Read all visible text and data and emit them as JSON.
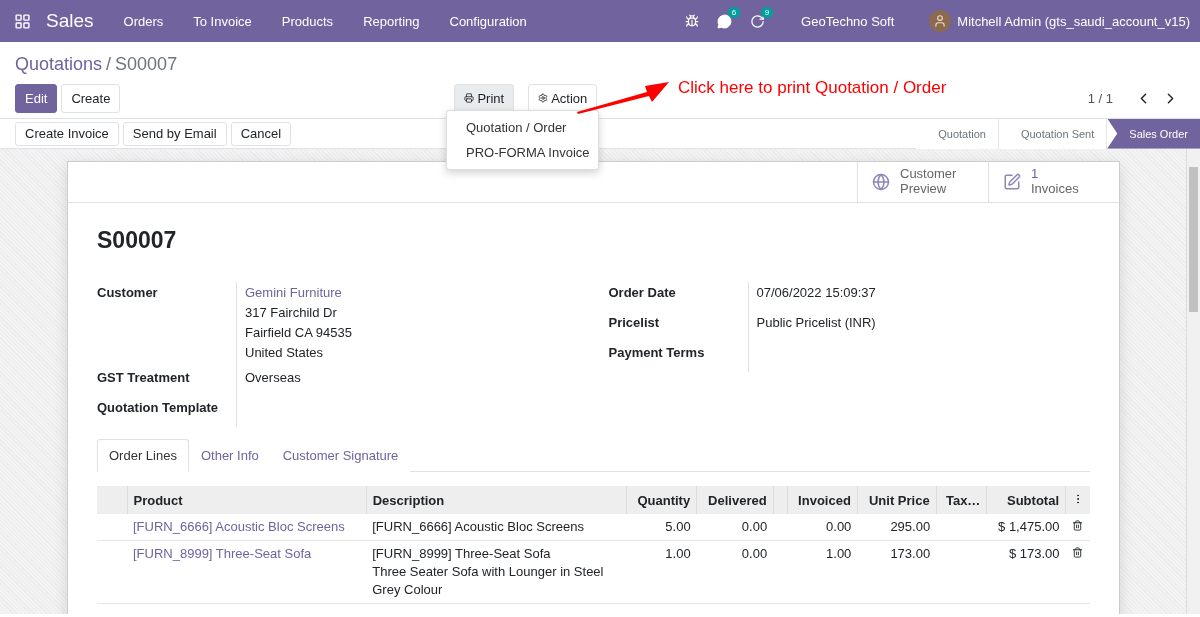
{
  "navbar": {
    "app": "Sales",
    "menu": [
      "Orders",
      "To Invoice",
      "Products",
      "Reporting",
      "Configuration"
    ],
    "messages_count": "6",
    "activities_count": "9",
    "company": "GeoTechno Soft",
    "user": "Mitchell Admin (gts_saudi_account_v15)"
  },
  "breadcrumb": {
    "parent": "Quotations",
    "separator": "/",
    "current": "S00007"
  },
  "buttons": [
    {
      "label": "Edit",
      "kind": "primary"
    },
    {
      "label": "Create",
      "kind": "secondary"
    }
  ],
  "print_button": {
    "label": "Print",
    "selected": true
  },
  "action_button": {
    "label": "Action"
  },
  "print_menu": [
    "Quotation / Order",
    "PRO-FORMA Invoice"
  ],
  "annotation": "Click here to print Quotation / Order",
  "pager": "1 / 1",
  "status_buttons": [
    "Create Invoice",
    "Send by Email",
    "Cancel"
  ],
  "stages": [
    {
      "label": "Quotation",
      "selected": false
    },
    {
      "label": "Quotation Sent",
      "selected": false
    },
    {
      "label": "Sales Order",
      "selected": true
    }
  ],
  "smart_buttons": [
    {
      "kind": "preview",
      "value": "Customer",
      "label": "Preview"
    },
    {
      "kind": "invoices",
      "value": "1",
      "label": "Invoices"
    }
  ],
  "record_name": "S00007",
  "left_fields": [
    {
      "label": "Customer",
      "lines": [
        "Gemini Furniture",
        "317 Fairchild Dr",
        "Fairfield CA 94535",
        "United States"
      ]
    },
    {
      "label": "GST Treatment",
      "lines": [
        "Overseas"
      ]
    },
    {
      "label": "Quotation Template"
    }
  ],
  "right_fields": [
    {
      "label": "Order Date",
      "lines": [
        "07/06/2022 15:09:37"
      ]
    },
    {
      "label": "Pricelist",
      "lines": [
        "Public Pricelist (INR)"
      ]
    },
    {
      "label": "Payment Terms"
    }
  ],
  "tabs": [
    {
      "label": "Order Lines",
      "selected": true
    },
    {
      "label": "Other Info",
      "selected": false
    },
    {
      "label": "Customer Signature",
      "selected": false
    }
  ],
  "table": {
    "columns": [
      "Product",
      "Description",
      "Quantity",
      "Delivered",
      "",
      "Invoiced",
      "Unit Price",
      "Tax…",
      "Subtotal"
    ],
    "rows": [
      {
        "product": "[FURN_6666] Acoustic Bloc Screens",
        "description": [
          "[FURN_6666] Acoustic Bloc Screens"
        ],
        "quantity": "5.00",
        "delivered": "0.00",
        "invoiced": "0.00",
        "unit_price": "295.00",
        "subtotal": "$ 1,475.00"
      },
      {
        "product": "[FURN_8999] Three-Seat Sofa",
        "description": [
          "[FURN_8999] Three-Seat Sofa",
          "Three Seater Sofa with Lounger in Steel",
          "Grey Colour"
        ],
        "quantity": "1.00",
        "delivered": "0.00",
        "invoiced": "1.00",
        "unit_price": "173.00",
        "subtotal": "$ 173.00"
      }
    ]
  }
}
